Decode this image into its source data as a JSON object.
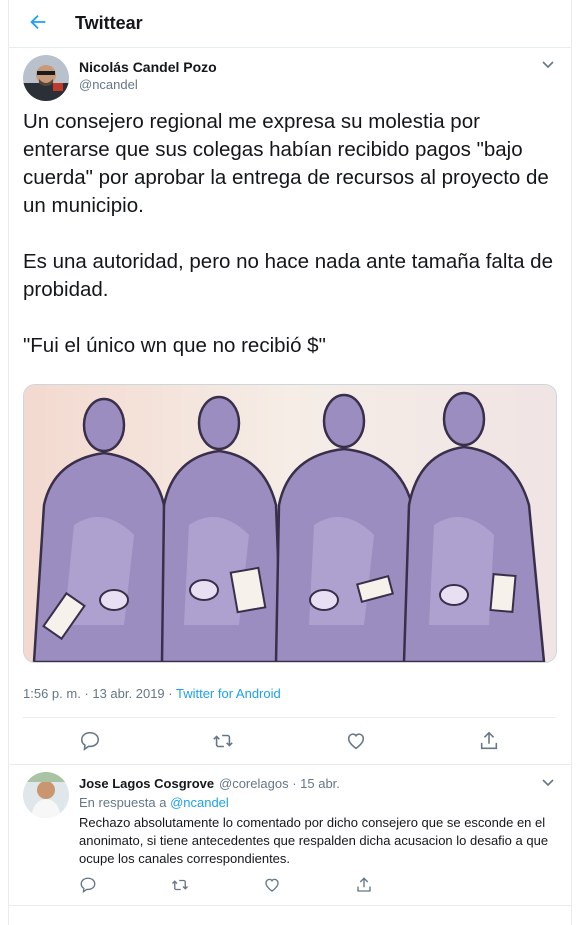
{
  "header": {
    "title": "Twittear"
  },
  "tweet": {
    "author_name": "Nicolás Candel Pozo",
    "author_handle": "@ncandel",
    "paragraphs": [
      "Un consejero regional me expresa su molestia por enterarse que sus colegas habían recibido pagos \"bajo cuerda\" por aprobar la entrega de recursos al proyecto de un municipio.",
      "Es una autoridad, pero no hace nada ante tamaña falta de probidad.",
      "\"Fui el único wn que no recibió $\""
    ],
    "timestamp": "1:56 p. m. · 13 abr. 2019 · ",
    "source": "Twitter for Android"
  },
  "icons": {
    "back": "arrow-left-icon",
    "more": "chevron-down-icon",
    "reply": "comment-icon",
    "retweet": "retweet-icon",
    "like": "heart-icon",
    "share": "share-icon"
  },
  "reply": {
    "author_name": "Jose Lagos Cosgrove",
    "author_handle": "@corelagos",
    "date": "· 15 abr.",
    "in_reply_prefix": "En respuesta a ",
    "in_reply_handle": "@ncandel",
    "text": "Rechazo absolutamente lo comentado por dicho consejero que se esconde en el anonimato, si tiene antecedentes que respalden dicha acusacion lo desafio a que ocupe los canales correspondientes."
  },
  "colors": {
    "accent": "#1da1f2",
    "muted": "#657786",
    "border": "#e6ecf0"
  }
}
